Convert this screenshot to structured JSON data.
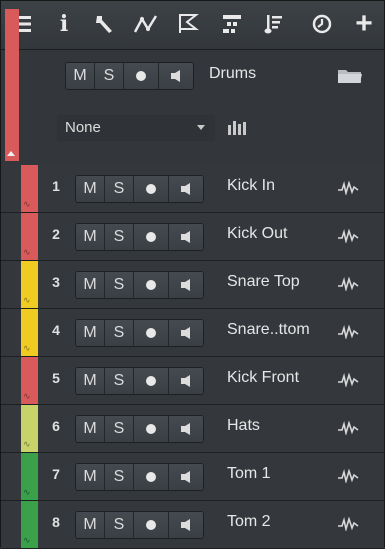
{
  "toolbar": {
    "icons": [
      "menu-icon",
      "info-icon",
      "wrench-icon",
      "automation-icon",
      "marker-flag-icon",
      "chord-icon",
      "score-icon",
      "clock-icon",
      "add-icon"
    ],
    "info_glyph": "i",
    "add_glyph": "+"
  },
  "folder": {
    "color": "#d85a5a",
    "mute_label": "M",
    "solo_label": "S",
    "name": "Drums",
    "dropdown_value": "None"
  },
  "tracks": [
    {
      "number": "1",
      "name": "Kick In",
      "color": "#d85a5a"
    },
    {
      "number": "2",
      "name": "Kick Out",
      "color": "#d85a5a"
    },
    {
      "number": "3",
      "name": "Snare Top",
      "color": "#f0cc22"
    },
    {
      "number": "4",
      "name": "Snare..ttom",
      "color": "#f0cc22"
    },
    {
      "number": "5",
      "name": "Kick Front",
      "color": "#d85a5a"
    },
    {
      "number": "6",
      "name": "Hats",
      "color": "#c8d46a"
    },
    {
      "number": "7",
      "name": "Tom 1",
      "color": "#3aa04a"
    },
    {
      "number": "8",
      "name": "Tom 2",
      "color": "#3aa04a"
    }
  ],
  "track_buttons": {
    "mute_label": "M",
    "solo_label": "S"
  }
}
